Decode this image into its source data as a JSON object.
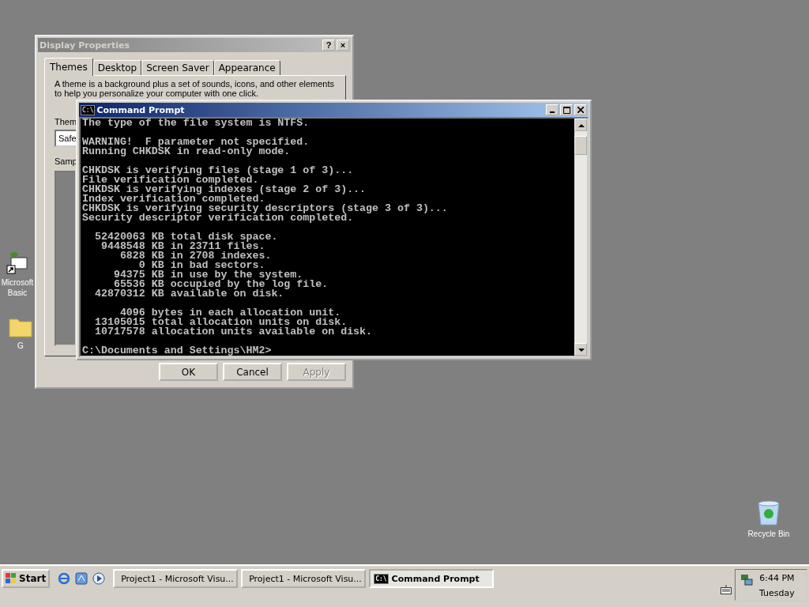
{
  "desktop": {
    "icons": [
      {
        "kind": "app",
        "label": "Microsoft Basic"
      },
      {
        "kind": "folder",
        "label": "G"
      },
      {
        "kind": "recycle",
        "label": "Recycle Bin"
      }
    ]
  },
  "display_properties": {
    "title": "Display Properties",
    "help_button": "?",
    "close_button": "×",
    "tabs": [
      {
        "label": "Themes",
        "selected": true
      },
      {
        "label": "Desktop",
        "selected": false
      },
      {
        "label": "Screen Saver",
        "selected": false
      },
      {
        "label": "Appearance",
        "selected": false
      }
    ],
    "description": "A theme is a background plus a set of sounds, icons, and other elements to help you personalize your computer with one click.",
    "theme_label": "Them",
    "theme_value": "Safe",
    "sample_label": "Samp",
    "buttons": [
      {
        "label": "OK",
        "disabled": false
      },
      {
        "label": "Cancel",
        "disabled": false
      },
      {
        "label": "Apply",
        "disabled": true
      }
    ]
  },
  "command_prompt": {
    "title": "Command Prompt",
    "icon_text": "C:\\",
    "blocks": [
      [
        "The type of the file system is NTFS."
      ],
      [
        "WARNING!  F parameter not specified.",
        "Running CHKDSK in read-only mode."
      ],
      [
        "CHKDSK is verifying files (stage 1 of 3)...",
        "File verification completed.",
        "CHKDSK is verifying indexes (stage 2 of 3)...",
        "Index verification completed.",
        "CHKDSK is verifying security descriptors (stage 3 of 3)...",
        "Security descriptor verification completed."
      ],
      [
        "  52420063 KB total disk space.",
        "   9448548 KB in 23711 files.",
        "      6828 KB in 2708 indexes.",
        "         0 KB in bad sectors.",
        "     94375 KB in use by the system.",
        "     65536 KB occupied by the log file.",
        "  42870312 KB available on disk."
      ],
      [
        "      4096 bytes in each allocation unit.",
        "  13105015 total allocation units on disk.",
        "  10717578 allocation units available on disk."
      ],
      [
        "C:\\Documents and Settings\\HM2>"
      ]
    ]
  },
  "taskbar": {
    "start": "Start",
    "tasks": [
      {
        "label": "Project1 - Microsoft Visu...",
        "kind": "vb",
        "selected": false
      },
      {
        "label": "Project1 - Microsoft Visu...",
        "kind": "vb",
        "selected": false
      },
      {
        "label": "Command Prompt",
        "kind": "cmd",
        "icon_text": "C:\\",
        "selected": true
      }
    ],
    "time": "6:44 PM",
    "day": "Tuesday"
  }
}
